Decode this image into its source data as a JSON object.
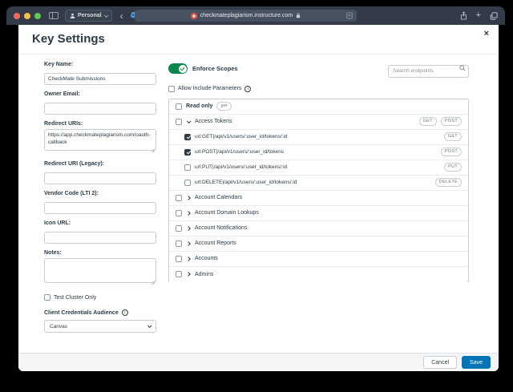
{
  "colors": {
    "accent_green": "#0b874b",
    "save_blue": "#0374b5",
    "navy": "#2d3b45"
  },
  "browser": {
    "profile_label": "Personal",
    "url": "checkmateplagiarism.instructure.com",
    "back_glyph": "‹",
    "plus_glyph": "+"
  },
  "modal": {
    "title": "Key Settings",
    "close_glyph": "×"
  },
  "form": {
    "fields": [
      {
        "label": "Key Name:",
        "value": "CheckMate Submissions"
      },
      {
        "label": "Owner Email:",
        "value": ""
      },
      {
        "label": "Redirect URIs:",
        "value": "https://app.checkmateplagiarism.com/oauth-callback"
      },
      {
        "label": "Redirect URI (Legacy):",
        "value": ""
      },
      {
        "label": "Vendor Code (LTI 2):",
        "value": ""
      },
      {
        "label": "Icon URL:",
        "value": ""
      },
      {
        "label": "Notes:",
        "value": ""
      }
    ],
    "test_cluster_label": "Test Cluster Only",
    "client_credentials_label": "Client Credentials Audience",
    "audience_value": "Canvas"
  },
  "scopes": {
    "enforce_label": "Enforce Scopes",
    "enforce_on": true,
    "search_placeholder": "Search endpoints",
    "allow_include_label": "Allow Include Parameters",
    "read_only_label": "Read only",
    "read_only_badge": "get",
    "rows": [
      {
        "type": "group",
        "label": "Access Tokens",
        "expanded": true,
        "badges": [
          "GET",
          "POST"
        ]
      },
      {
        "type": "scope",
        "label": "url:GET|/api/v1/users/:user_id/tokens/:id",
        "method": "GET",
        "checked": true
      },
      {
        "type": "scope",
        "label": "url:POST|/api/v1/users/:user_id/tokens",
        "method": "POST",
        "checked": true
      },
      {
        "type": "scope",
        "label": "url:PUT|/api/v1/users/:user_id/tokens/:id",
        "method": "PUT",
        "checked": false
      },
      {
        "type": "scope",
        "label": "url:DELETE|/api/v1/users/:user_id/tokens/:id",
        "method": "DELETE",
        "checked": false
      },
      {
        "type": "group",
        "label": "Account Calendars",
        "expanded": false
      },
      {
        "type": "group",
        "label": "Account Domain Lookups",
        "expanded": false
      },
      {
        "type": "group",
        "label": "Account Notifications",
        "expanded": false
      },
      {
        "type": "group",
        "label": "Account Reports",
        "expanded": false
      },
      {
        "type": "group",
        "label": "Accounts",
        "expanded": false
      },
      {
        "type": "group",
        "label": "Admins",
        "expanded": false
      }
    ]
  },
  "footer": {
    "cancel_label": "Cancel",
    "save_label": "Save"
  }
}
